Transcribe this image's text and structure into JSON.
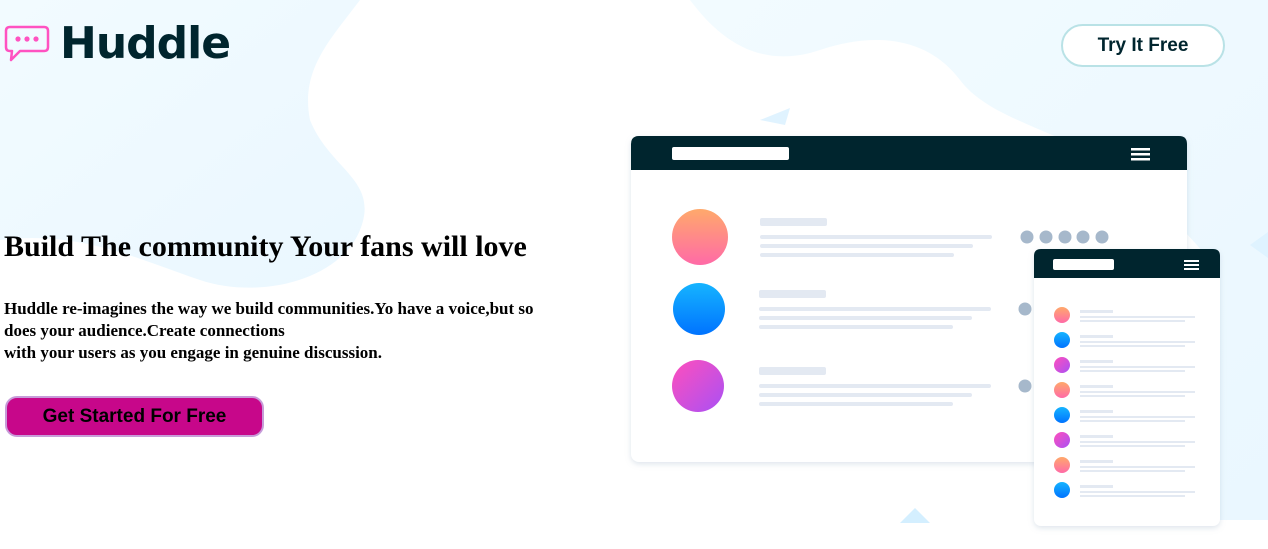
{
  "brand": {
    "name": "Huddle",
    "logo_icon": "chat-bubble-icon",
    "logo_color": "#ff52c1"
  },
  "header": {
    "try_label": "Try It Free"
  },
  "hero": {
    "title": "Build The community Your fans will love",
    "description_lines": [
      "Huddle re-imagines the way we build communities.Yo have a voice,but so",
      "does your audience.Create connections",
      "with your users as you engage in genuine discussion."
    ],
    "cta_label": "Get Started For Free"
  },
  "colors": {
    "dark": "#00252e",
    "accent": "#c7078a",
    "background_blob": "#f0faff"
  },
  "mockup": {
    "main_window": {
      "avatars": [
        "orange-pink",
        "blue",
        "pink-purple"
      ]
    },
    "side_window": {
      "avatars": [
        "orange-pink",
        "blue",
        "pink-purple",
        "orange-pink",
        "blue",
        "pink-purple",
        "orange-pink",
        "blue"
      ]
    }
  }
}
